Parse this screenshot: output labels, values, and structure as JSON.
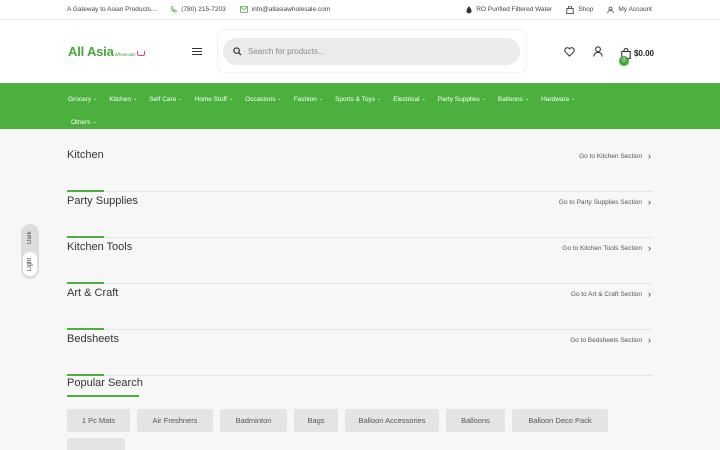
{
  "topbar": {
    "tagline": "A Gateway to Asian Products...",
    "phone": "(780) 215-7203",
    "email": "info@allasiawholesale.com",
    "water": "RO Purified Filtered Water",
    "shop": "Shop",
    "account": "My Account"
  },
  "header": {
    "logo_main": "All Asia",
    "logo_sub": "Wholesale",
    "search_placeholder": "Search for products...",
    "cart_count": "0",
    "cart_total": "$0.00"
  },
  "nav": {
    "row1": [
      "Grocery",
      "Kitchen",
      "Self Care",
      "Home Stuff",
      "Occasions",
      "Fashion",
      "Sports & Toys",
      "Electrical",
      "Party Supplies",
      "Balloons",
      "Hardware"
    ],
    "row2": [
      "Others"
    ]
  },
  "theme_toggle": {
    "dark": "Dark",
    "light": "Light"
  },
  "sections": [
    {
      "title": "Kitchen",
      "link": "Go to Kitchen Section"
    },
    {
      "title": "Party Supplies",
      "link": "Go to Party Supplies Section"
    },
    {
      "title": "Kitchen Tools",
      "link": "Go to Kitchen Tools Section"
    },
    {
      "title": "Art & Craft",
      "link": "Go to Art & Craft Section"
    },
    {
      "title": "Bedsheets",
      "link": "Go to Bedsheets Section"
    }
  ],
  "popular": {
    "title": "Popular Search",
    "tags": [
      "1 Pc Mats",
      "Air Freshners",
      "Badminton",
      "Bags",
      "Balloon Accessories",
      "Balloons",
      "Balloon Deco Pack"
    ]
  },
  "colors": {
    "brand_green": "#4cb03e",
    "accent_pink": "#e23a9e"
  }
}
